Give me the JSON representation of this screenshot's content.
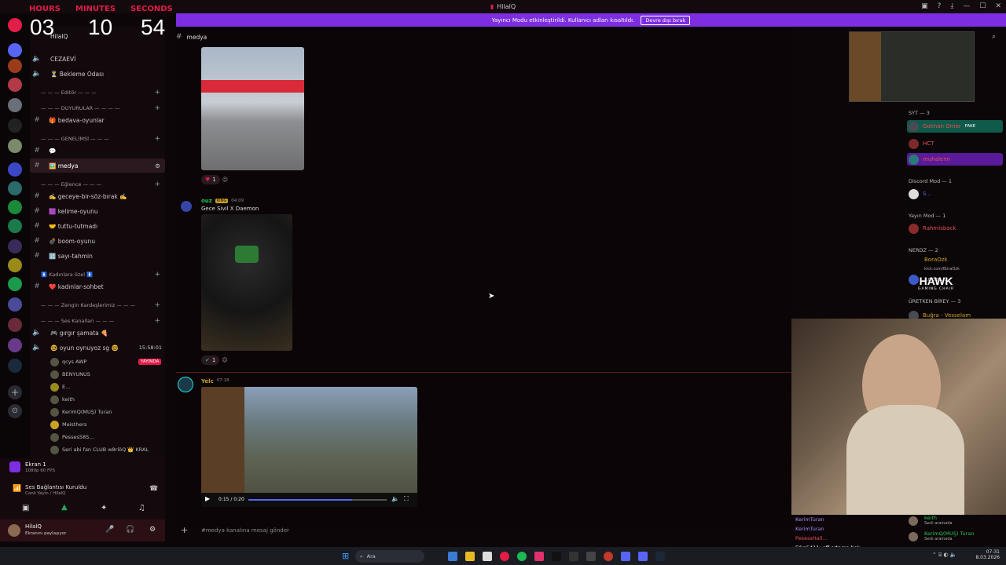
{
  "window": {
    "title": "HilalQ"
  },
  "banner": {
    "text": "Yayıncı Modu etkinleştirildi. Kullanıcı adları kısaltıldı.",
    "button": "Devre dışı bırak"
  },
  "timer": {
    "hours_label": "HOURS",
    "minutes_label": "MINUTES",
    "seconds_label": "SECONDS",
    "hours": "03",
    "minutes": "10",
    "seconds": "54"
  },
  "server": {
    "name": "HilalQ"
  },
  "sidebar": {
    "items": [
      {
        "type": "voice",
        "label": "CEZAEVİ"
      },
      {
        "type": "voice",
        "label": "⏳ Bekleme Odası"
      },
      {
        "type": "cat",
        "label": "— — — Editör — — —"
      },
      {
        "type": "cat",
        "label": "— — — DUYURULAR — — — —"
      },
      {
        "type": "chan",
        "label": "🎁 bedava-oyunlar"
      },
      {
        "type": "cat",
        "label": "— — — GENELİMSİ — — —"
      },
      {
        "type": "chan",
        "label": "💬"
      },
      {
        "type": "chan",
        "label": "🖼️ medya"
      },
      {
        "type": "cat",
        "label": "— — — Eğlence — — —"
      },
      {
        "type": "chan",
        "label": "✍️ geceye-bir-söz-bırak ✍️"
      },
      {
        "type": "chan",
        "label": "🟪 kelime-oyunu"
      },
      {
        "type": "chan",
        "label": "🤝 tuttu-tutmadı"
      },
      {
        "type": "chan",
        "label": "💣 boom-oyunu"
      },
      {
        "type": "chan",
        "label": "🔢 sayı-tahmin"
      },
      {
        "type": "cat",
        "label": "🚺 Kadınlara özel 🚺"
      },
      {
        "type": "chan",
        "label": "❤️ kadınlar-sohbet"
      },
      {
        "type": "cat",
        "label": "— — — Zengin Kardeşlerimiz — — —"
      },
      {
        "type": "cat",
        "label": "— — — Ses Kanalları — — —"
      },
      {
        "type": "voice",
        "label": "🎮 gırgır şamata 🍕"
      },
      {
        "type": "voice",
        "label": "🤓 oyun oynuyoz sg 🤓"
      }
    ],
    "voice_time": "15:58:01",
    "voice_users": [
      {
        "name": "qcys AWP",
        "badge": "YAYINDA"
      },
      {
        "name": "BENYUNUS"
      },
      {
        "name": "E..."
      },
      {
        "name": "keith"
      },
      {
        "name": "KerimQ(MUŞ) Turan"
      },
      {
        "name": "Meisthers"
      },
      {
        "name": "Pesses58S..."
      },
      {
        "name": "Seri abi fan CLUB w8rlöQ 👑 KRAL"
      }
    ]
  },
  "voice_panel": {
    "screen_title": "Ekran 1",
    "screen_sub": "1080p 60 FPS",
    "status": "Ses Bağlantısı Kuruldu",
    "status_sub": "Canlı Yayın / HilalQ"
  },
  "user": {
    "name": "HilalQ",
    "sub": "Ekranını paylaşıyor"
  },
  "channel": {
    "name": "medya",
    "input_placeholder": "#medya kanalına mesaj gönder"
  },
  "messages": [
    {
      "reaction_count": "1"
    },
    {
      "author": "ouz",
      "tag": "KING",
      "time": "04:09",
      "text": "Gece Sivil X Daemon",
      "reaction_count": "1"
    },
    {
      "author": "Yelc",
      "time": "07:18",
      "video_time": "0:15 / 0:20"
    }
  ],
  "members": {
    "groups": [
      {
        "header": "SYT — 3",
        "names": [
          "Gokhan Omer",
          "HCT",
          "muhalenn"
        ],
        "tag": "FAKE"
      },
      {
        "header": "Discord Mod — 1",
        "names": [
          "S..."
        ]
      },
      {
        "header": "Yayın Mod — 1",
        "names": [
          "Rahmisback"
        ]
      },
      {
        "header": "NERDZ — 2",
        "names": [
          "BoraOzk",
          "...ndos..."
        ],
        "sub": "kick.com/BoraOzk"
      },
      {
        "header": "ÜRETKEN BİREY — 3",
        "names": [
          "Buğra - Vesselam"
        ]
      }
    ]
  },
  "chat": [
    {
      "name": "KerimTuran",
      "text": ""
    },
    {
      "name": "KerimTuran",
      "text": ""
    },
    {
      "name": "PesessHall...",
      "text": ""
    },
    {
      "name": "Frkn5411",
      "text": ": off ortama bak"
    },
    {
      "name": "zilFalcoN28",
      "text": ":"
    }
  ],
  "overlay": {
    "logo": "HAWK",
    "logo_sub": "GAMING CHAIR",
    "voice_right": [
      {
        "name": "keith",
        "sub": "Sesli aramada"
      },
      {
        "name": "KerimQ(MUŞ) Turan",
        "sub": "Sesli aramada"
      }
    ]
  },
  "taskbar": {
    "search": "Ara",
    "time": "07:31",
    "date": "8.03.2026"
  },
  "colors": {
    "accent": "#7c2ee0",
    "timer_label": "#e11d48",
    "link_teal": "#1fb8a4"
  }
}
